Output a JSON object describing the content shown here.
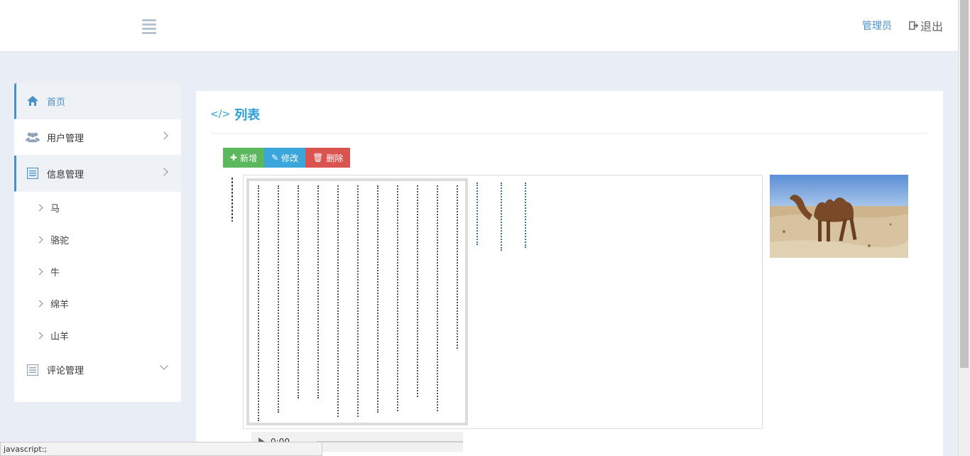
{
  "header": {
    "menu_icon": "list-icon",
    "admin_label": "管理员",
    "logout_label": "退出",
    "logout_icon": "sign-out-icon"
  },
  "sidebar": {
    "items": [
      {
        "label": "首页",
        "icon": "home-icon"
      },
      {
        "label": "用户管理",
        "icon": "users-icon"
      },
      {
        "label": "信息管理",
        "icon": "list-alt-icon"
      },
      {
        "label": "评论管理",
        "icon": "list-alt-icon"
      }
    ],
    "sub_items": [
      {
        "label": "马"
      },
      {
        "label": "骆驼"
      },
      {
        "label": "牛"
      },
      {
        "label": "绵羊"
      },
      {
        "label": "山羊"
      }
    ]
  },
  "main": {
    "title": "列表",
    "buttons": {
      "add": "新增",
      "edit": "修改",
      "delete": "删除"
    },
    "audio": {
      "time": "0:00"
    }
  },
  "status_bar": {
    "text": "javascript:;"
  },
  "colors": {
    "accent": "#2a9fd6",
    "add": "#5cb85c",
    "edit": "#3aa6dc",
    "delete": "#d9534f"
  }
}
